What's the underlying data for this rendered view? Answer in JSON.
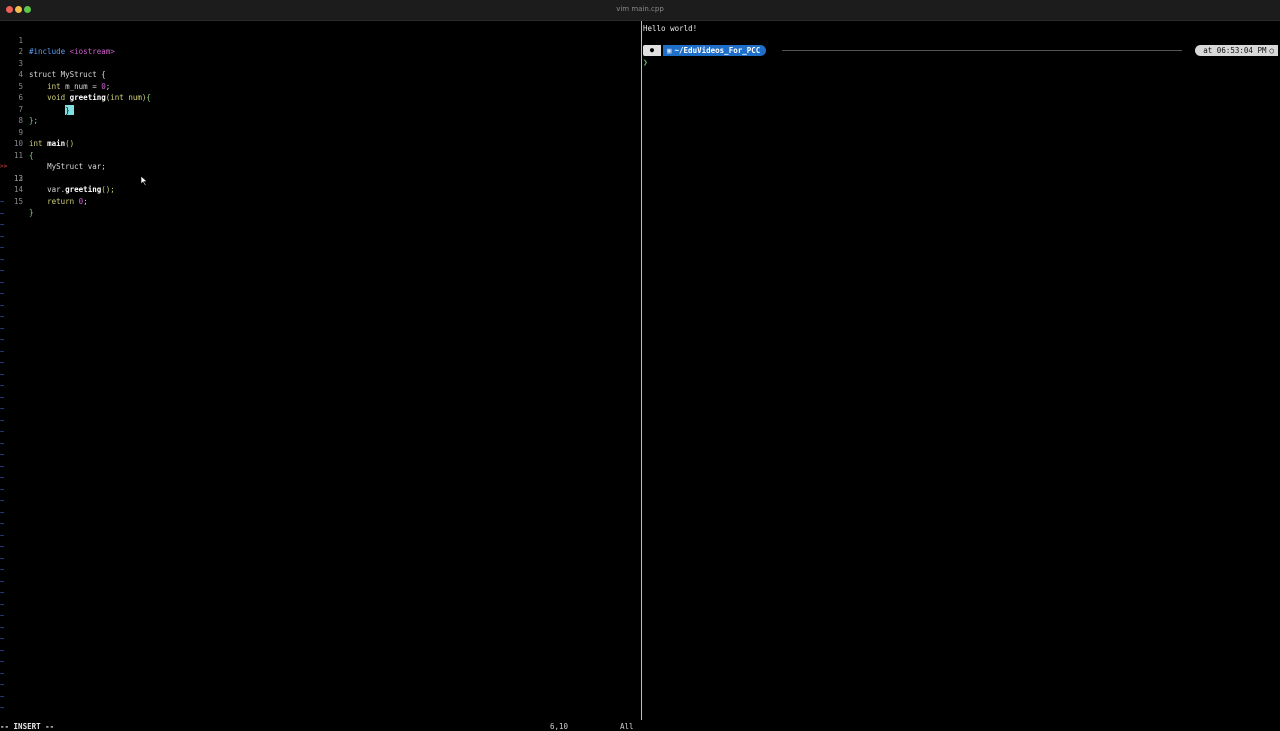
{
  "window": {
    "title": "vim main.cpp"
  },
  "editor": {
    "lines": [
      {
        "n": "1"
      },
      {
        "n": "2"
      },
      {
        "n": "3"
      },
      {
        "n": "4"
      },
      {
        "n": "5"
      },
      {
        "n": "6"
      },
      {
        "n": "7"
      },
      {
        "n": "8"
      },
      {
        "n": "9"
      },
      {
        "n": "10"
      },
      {
        "n": "11"
      },
      {
        "n": "12"
      },
      {
        "n": "13"
      },
      {
        "n": "14"
      },
      {
        "n": "15"
      }
    ],
    "code": {
      "l1_pre": "#include",
      "l1_str": "<iostream>",
      "l3": "struct MyStruct {",
      "l4_type": "int",
      "l4_rest": " m_num = ",
      "l4_num": "0",
      "l4_end": ";",
      "l5_type": "void",
      "l5_fn": "greeting",
      "l5_args": "(int num)",
      "l5_brace": "{",
      "l6_cursor": "}",
      "l7": "};",
      "l9_type": "int",
      "l9_fn": "main",
      "l9_paren": "()",
      "l10": "{",
      "l11": "MyStruct var;",
      "l12_obj": "var.",
      "l12_fn": "greeting",
      "l12_rest": "();",
      "l14_kw": "return",
      "l14_num": "0",
      "l14_end": ";",
      "l15": "}"
    },
    "tilde": "~",
    "mode": "-- INSERT --",
    "position": "6,10",
    "scroll": "All"
  },
  "terminal": {
    "output": "Hello world!",
    "prompt_path": "~/EduVideos_For_PCC",
    "prompt_time": "at 06:53:04 PM",
    "prompt_char": "❯"
  },
  "colors": {
    "path_segment": "#1f6fc8",
    "cursor": "#7fe0e0",
    "tilde": "#3a5fd0"
  }
}
